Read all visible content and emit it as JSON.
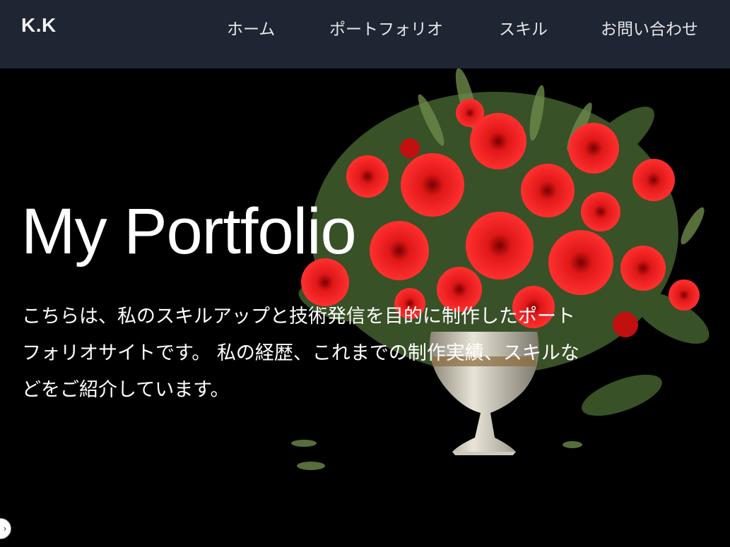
{
  "navbar": {
    "logo": "K.K",
    "links": [
      {
        "label": "ホーム"
      },
      {
        "label": "ポートフォリオ"
      },
      {
        "label": "スキル"
      },
      {
        "label": "お問い合わせ"
      }
    ]
  },
  "hero": {
    "title": "My Portfolio",
    "description": "こちらは、私のスキルアップと技術発信を目的に制作したポートフォリオサイトです。 私の経歴、これまでの制作実績、スキルなどをご紹介しています。",
    "image": "red-flower-bouquet-in-vase"
  },
  "colors": {
    "navbar_bg": "#1e2533",
    "hero_bg": "#000000",
    "text": "#ffffff",
    "flower_red": "#e01818"
  },
  "corner_button_icon": "chevron-right-icon"
}
